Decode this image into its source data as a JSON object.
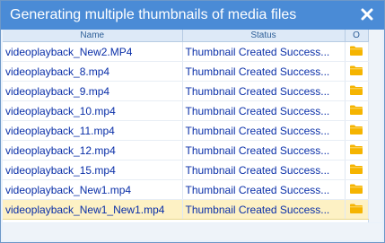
{
  "dialog": {
    "title": "Generating multiple thumbnails of media files",
    "close_icon": "close-icon"
  },
  "grid": {
    "columns": [
      "Name",
      "Status",
      "O"
    ],
    "rows": [
      {
        "name": "videoplayback_New2.MP4",
        "status": "Thumbnail Created Success...",
        "icon": "folder-icon"
      },
      {
        "name": "videoplayback_8.mp4",
        "status": "Thumbnail Created Success...",
        "icon": "folder-icon"
      },
      {
        "name": "videoplayback_9.mp4",
        "status": "Thumbnail Created Success...",
        "icon": "folder-icon"
      },
      {
        "name": "videoplayback_10.mp4",
        "status": "Thumbnail Created Success...",
        "icon": "folder-icon"
      },
      {
        "name": "videoplayback_11.mp4",
        "status": "Thumbnail Created Success...",
        "icon": "folder-icon"
      },
      {
        "name": "videoplayback_12.mp4",
        "status": "Thumbnail Created Success...",
        "icon": "folder-icon"
      },
      {
        "name": "videoplayback_15.mp4",
        "status": "Thumbnail Created Success...",
        "icon": "folder-icon"
      },
      {
        "name": "videoplayback_New1.mp4",
        "status": "Thumbnail Created Success...",
        "icon": "folder-icon"
      },
      {
        "name": "videoplayback_New1_New1.mp4",
        "status": "Thumbnail Created Success...",
        "icon": "folder-icon"
      }
    ],
    "selected_row": 8
  },
  "colors": {
    "title_bar": "#4a8bd6",
    "row_text": "#0a2fa8",
    "selected_row": "#fdf1c4",
    "folder": "#f5b400"
  }
}
